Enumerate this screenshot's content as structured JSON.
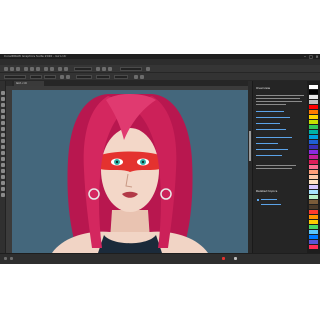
{
  "window": {
    "title": "CorelDRAW Graphics Suite 2020 - Girl.cdr"
  },
  "menu": [
    "File",
    "Edit",
    "View",
    "Layout",
    "Object",
    "Effects",
    "Bitmaps",
    "Text",
    "Table",
    "Tools",
    "Window",
    "Help"
  ],
  "document": {
    "tab_label": "Girl.cdr"
  },
  "panel": {
    "title": "Overview",
    "section2": "Related topics"
  },
  "palette": {
    "colors": [
      "#ffffff",
      "#000000",
      "#e6e6e6",
      "#bfbfbf",
      "#ff0000",
      "#ff7a00",
      "#ffd400",
      "#c8e000",
      "#34c759",
      "#00b3a6",
      "#00a0e0",
      "#1f5fd6",
      "#3a2fb8",
      "#8a2be2",
      "#c41f9a",
      "#e01e5a",
      "#ff6f91",
      "#ff9e7a",
      "#ffc9a8",
      "#ffe1c2",
      "#d8c7ff",
      "#a6e3ff",
      "#b8f0c8",
      "#7a5c3a",
      "#4a3a2a",
      "#ff3b30",
      "#ff9500",
      "#ffcc00",
      "#4cd964",
      "#5ac8fa",
      "#007aff",
      "#5856d6",
      "#ff2d55"
    ]
  },
  "colors": {
    "canvas": "#44677c",
    "hair": "#c8215a",
    "mask": "#e4322f",
    "skin": "#f3d7c8",
    "link": "#5ca3e8"
  }
}
